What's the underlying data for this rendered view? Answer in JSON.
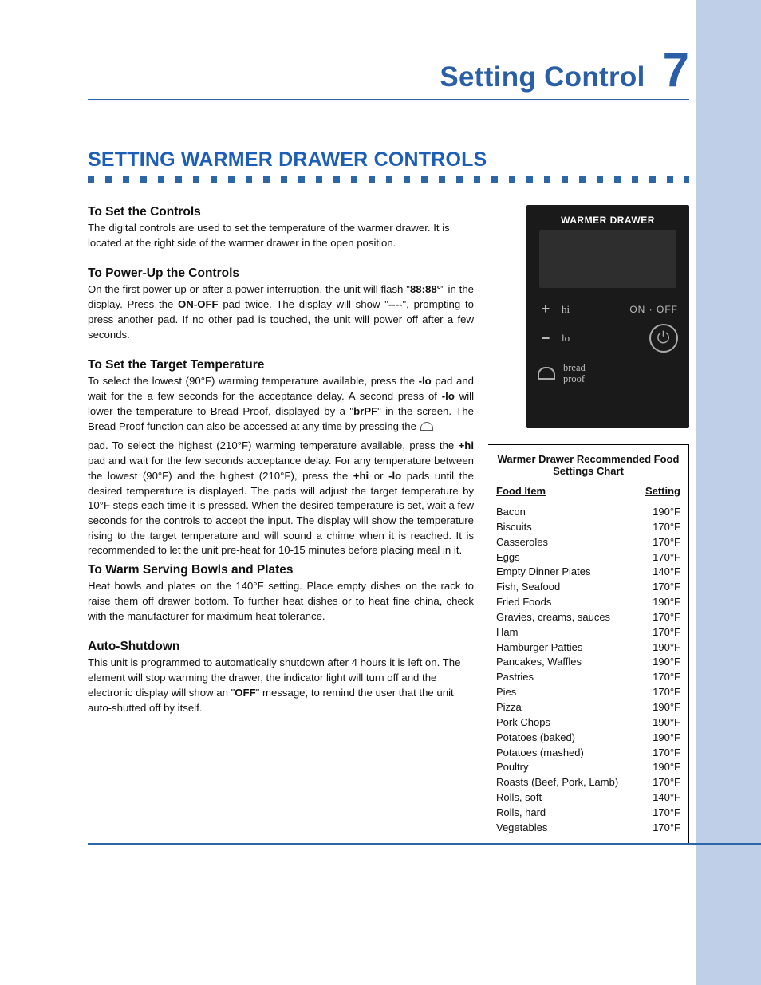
{
  "header": {
    "title": "Setting Control",
    "chapter_number": "7"
  },
  "h2": "SETTING WARMER DRAWER CONTROLS",
  "sections": {
    "set_controls": {
      "heading": "To Set the Controls",
      "body": "The digital controls are used to set the temperature of the warmer drawer. It is located at the right side of the warmer drawer in the open position."
    },
    "power_up": {
      "heading": "To Power-Up the Controls",
      "body_pre": "On the first power-up or after  a power interruption, the unit will flash \"",
      "bold1": "88:88°",
      "body_mid1": "\" in the display. Press the ",
      "bold2": "ON-OFF",
      "body_mid2": " pad twice. The display will show \"",
      "bold3": "----",
      "body_post": "\", prompting to press another pad. If no other pad is touched, the unit will power off after a few seconds."
    },
    "target_temp": {
      "heading": "To Set the Target Temperature",
      "para1_pre": "To select the lowest (90°F) warming temperature available, press the ",
      "lo1": "-lo",
      "para1_mid1": " pad and wait for the a few seconds for the acceptance delay. A second press of ",
      "lo2": "-lo",
      "para1_mid2": " will lower the temperature to Bread Proof, displayed by a \"",
      "brpf": "brPF",
      "para1_mid3": "\" in the screen. The Bread Proof function can also be accessed at any time by pressing the ",
      "para2_pre": "pad. To select the highest (210°F) warming temperature available, press the ",
      "hi": "+hi",
      "para2_mid1": " pad and wait for the few seconds acceptance delay. For any temperature between the lowest (90°F) and the highest (210°F), press the ",
      "hi2": "+hi",
      "para2_or": " or ",
      "lo3": "-lo",
      "para2_post": " pads until the desired temperature is displayed. The pads will adjust the target temperature by 10°F steps each time it is pressed. When the desired temperature is set, wait a few seconds for the controls to accept the input. The display will show the temperature rising to the target temperature and will sound a chime when it is reached. It is recommended to let the unit pre-heat for 10-15 minutes before placing meal in it."
    },
    "warm_bowls": {
      "heading": "To Warm Serving Bowls and Plates",
      "body": "Heat bowls and plates on the 140°F setting. Place empty dishes on the rack to raise them off drawer bottom. To further heat dishes or to heat fine china, check with the manufacturer for maximum heat tolerance."
    },
    "auto_shutdown": {
      "heading": "Auto-Shutdown",
      "body_pre": "This unit is programmed to automatically shutdown after 4 hours it is left on. The element will stop warming the drawer, the indicator light will turn off and the electronic display will show an \"",
      "off": "OFF",
      "body_post": "\" message, to remind the user that the unit auto-shutted off by itself."
    }
  },
  "panel": {
    "title": "WARMER DRAWER",
    "hi_label": "hi",
    "lo_label": "lo",
    "onoff_label": "ON · OFF",
    "breadproof_label": "bread\nproof"
  },
  "chart": {
    "title": "Warmer Drawer Recommended Food Settings Chart",
    "col_food": "Food Item",
    "col_setting": "Setting",
    "rows": [
      {
        "name": "Bacon",
        "setting": "190°F"
      },
      {
        "name": "Biscuits",
        "setting": "170°F"
      },
      {
        "name": "Casseroles",
        "setting": "170°F"
      },
      {
        "name": "Eggs",
        "setting": "170°F"
      },
      {
        "name": "Empty Dinner Plates",
        "setting": "140°F"
      },
      {
        "name": "Fish, Seafood",
        "setting": "170°F"
      },
      {
        "name": "Fried Foods",
        "setting": "190°F"
      },
      {
        "name": "Gravies, creams, sauces",
        "setting": "170°F"
      },
      {
        "name": "Ham",
        "setting": "170°F"
      },
      {
        "name": "Hamburger Patties",
        "setting": "190°F"
      },
      {
        "name": "Pancakes, Waffles",
        "setting": "190°F"
      },
      {
        "name": "Pastries",
        "setting": "170°F"
      },
      {
        "name": "Pies",
        "setting": "170°F"
      },
      {
        "name": "Pizza",
        "setting": "190°F"
      },
      {
        "name": "Pork Chops",
        "setting": "190°F"
      },
      {
        "name": "Potatoes (baked)",
        "setting": "190°F"
      },
      {
        "name": "Potatoes (mashed)",
        "setting": "170°F"
      },
      {
        "name": "Poultry",
        "setting": "190°F"
      },
      {
        "name": "Roasts (Beef, Pork, Lamb)",
        "setting": "170°F"
      },
      {
        "name": "Rolls, soft",
        "setting": "140°F"
      },
      {
        "name": "Rolls, hard",
        "setting": "170°F"
      },
      {
        "name": "Vegetables",
        "setting": "170°F"
      }
    ]
  },
  "chart_data": {
    "type": "table",
    "title": "Warmer Drawer Recommended Food Settings Chart",
    "columns": [
      "Food Item",
      "Setting"
    ],
    "rows": [
      [
        "Bacon",
        "190°F"
      ],
      [
        "Biscuits",
        "170°F"
      ],
      [
        "Casseroles",
        "170°F"
      ],
      [
        "Eggs",
        "170°F"
      ],
      [
        "Empty Dinner Plates",
        "140°F"
      ],
      [
        "Fish, Seafood",
        "170°F"
      ],
      [
        "Fried Foods",
        "190°F"
      ],
      [
        "Gravies, creams, sauces",
        "170°F"
      ],
      [
        "Ham",
        "170°F"
      ],
      [
        "Hamburger Patties",
        "190°F"
      ],
      [
        "Pancakes, Waffles",
        "190°F"
      ],
      [
        "Pastries",
        "170°F"
      ],
      [
        "Pies",
        "170°F"
      ],
      [
        "Pizza",
        "190°F"
      ],
      [
        "Pork Chops",
        "190°F"
      ],
      [
        "Potatoes (baked)",
        "190°F"
      ],
      [
        "Potatoes (mashed)",
        "170°F"
      ],
      [
        "Poultry",
        "190°F"
      ],
      [
        "Roasts (Beef, Pork, Lamb)",
        "170°F"
      ],
      [
        "Rolls, soft",
        "140°F"
      ],
      [
        "Rolls, hard",
        "170°F"
      ],
      [
        "Vegetables",
        "170°F"
      ]
    ]
  }
}
